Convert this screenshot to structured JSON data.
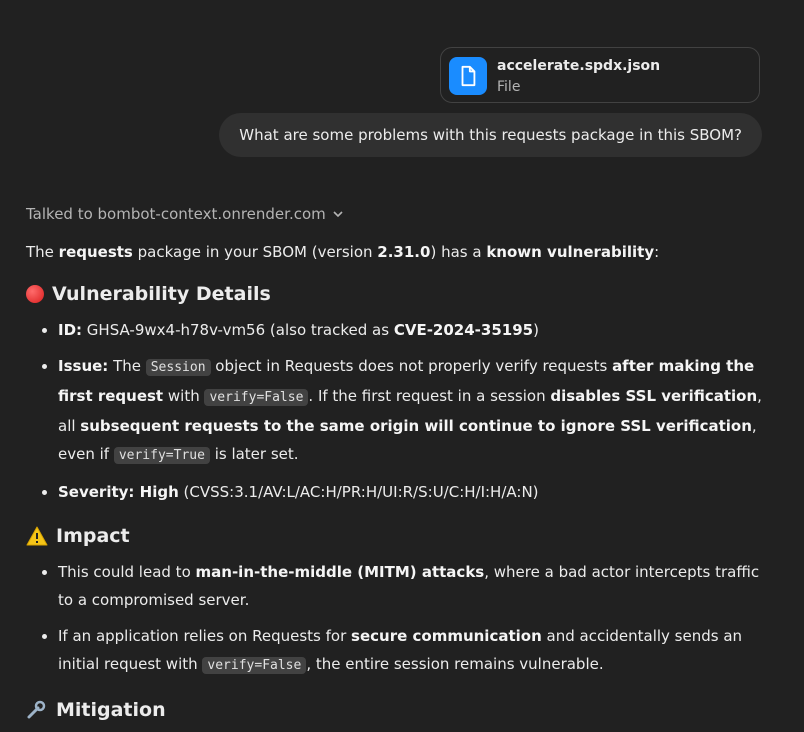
{
  "attachment": {
    "name": "accelerate.spdx.json",
    "type": "File"
  },
  "user_message": "What are some problems with this requests package in this SBOM?",
  "tool_status": "Talked to bombot-context.onrender.com",
  "intro": {
    "t1": "The ",
    "b1": "requests",
    "t2": " package in your SBOM (version ",
    "b2": "2.31.0",
    "t3": ") has a ",
    "b3": "known vulnerability",
    "t4": ":"
  },
  "section1": {
    "title": "Vulnerability Details",
    "icon": "red-circle-icon",
    "items": [
      {
        "label": "ID:",
        "t1": " GHSA-9wx4-h78v-vm56 (also tracked as ",
        "b1": "CVE-2024-35195",
        "t2": ")"
      },
      {
        "label": "Issue:",
        "t1": " The ",
        "c1": "Session",
        "t2": " object in Requests does not properly verify requests ",
        "b1": "after making the first request",
        "t3": " with ",
        "c2": "verify=False",
        "t4": ". If the first request in a session ",
        "b2": "disables SSL verification",
        "t5": ", all ",
        "b3": "subsequent requests to the same origin will continue to ignore SSL verification",
        "t6": ", even if ",
        "c3": "verify=True",
        "t7": " is later set."
      },
      {
        "label": "Severity:",
        "b1": " High",
        "t1": " (CVSS:3.1/AV:L/AC:H/PR:H/UI:R/S:U/C:H/I:H/A:N)"
      }
    ]
  },
  "section2": {
    "title": "Impact",
    "icon": "warning-icon",
    "items": [
      {
        "t1": "This could lead to ",
        "b1": "man-in-the-middle (MITM) attacks",
        "t2": ", where a bad actor intercepts traffic to a compromised server."
      },
      {
        "t1": "If an application relies on Requests for ",
        "b1": "secure communication",
        "t2": " and accidentally sends an initial request with ",
        "c1": "verify=False",
        "t3": ", the entire session remains vulnerable."
      }
    ]
  },
  "section3": {
    "title": "Mitigation",
    "icon": "tools-icon"
  }
}
